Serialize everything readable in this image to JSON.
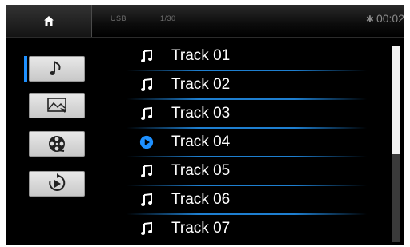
{
  "status": {
    "source": "USB",
    "track_counter": "1/30",
    "clock": "00:02"
  },
  "menu": {
    "items": [
      {
        "name": "music",
        "icon": "music-note-icon",
        "selected": true
      },
      {
        "name": "pictures",
        "icon": "picture-icon",
        "selected": false
      },
      {
        "name": "video",
        "icon": "film-reel-icon",
        "selected": false
      },
      {
        "name": "repeat",
        "icon": "repeat-play-icon",
        "selected": false
      }
    ]
  },
  "tracks": [
    {
      "label": "Track 01",
      "playing": false
    },
    {
      "label": "Track 02",
      "playing": false
    },
    {
      "label": "Track 03",
      "playing": false
    },
    {
      "label": "Track 04",
      "playing": true
    },
    {
      "label": "Track 05",
      "playing": false
    },
    {
      "label": "Track 06",
      "playing": false
    },
    {
      "label": "Track 07",
      "playing": false
    }
  ],
  "scroll": {
    "visible_fraction": 0.55,
    "position": 0
  },
  "colors": {
    "accent": "#1e90ff",
    "separator": "#1e7fd0"
  }
}
